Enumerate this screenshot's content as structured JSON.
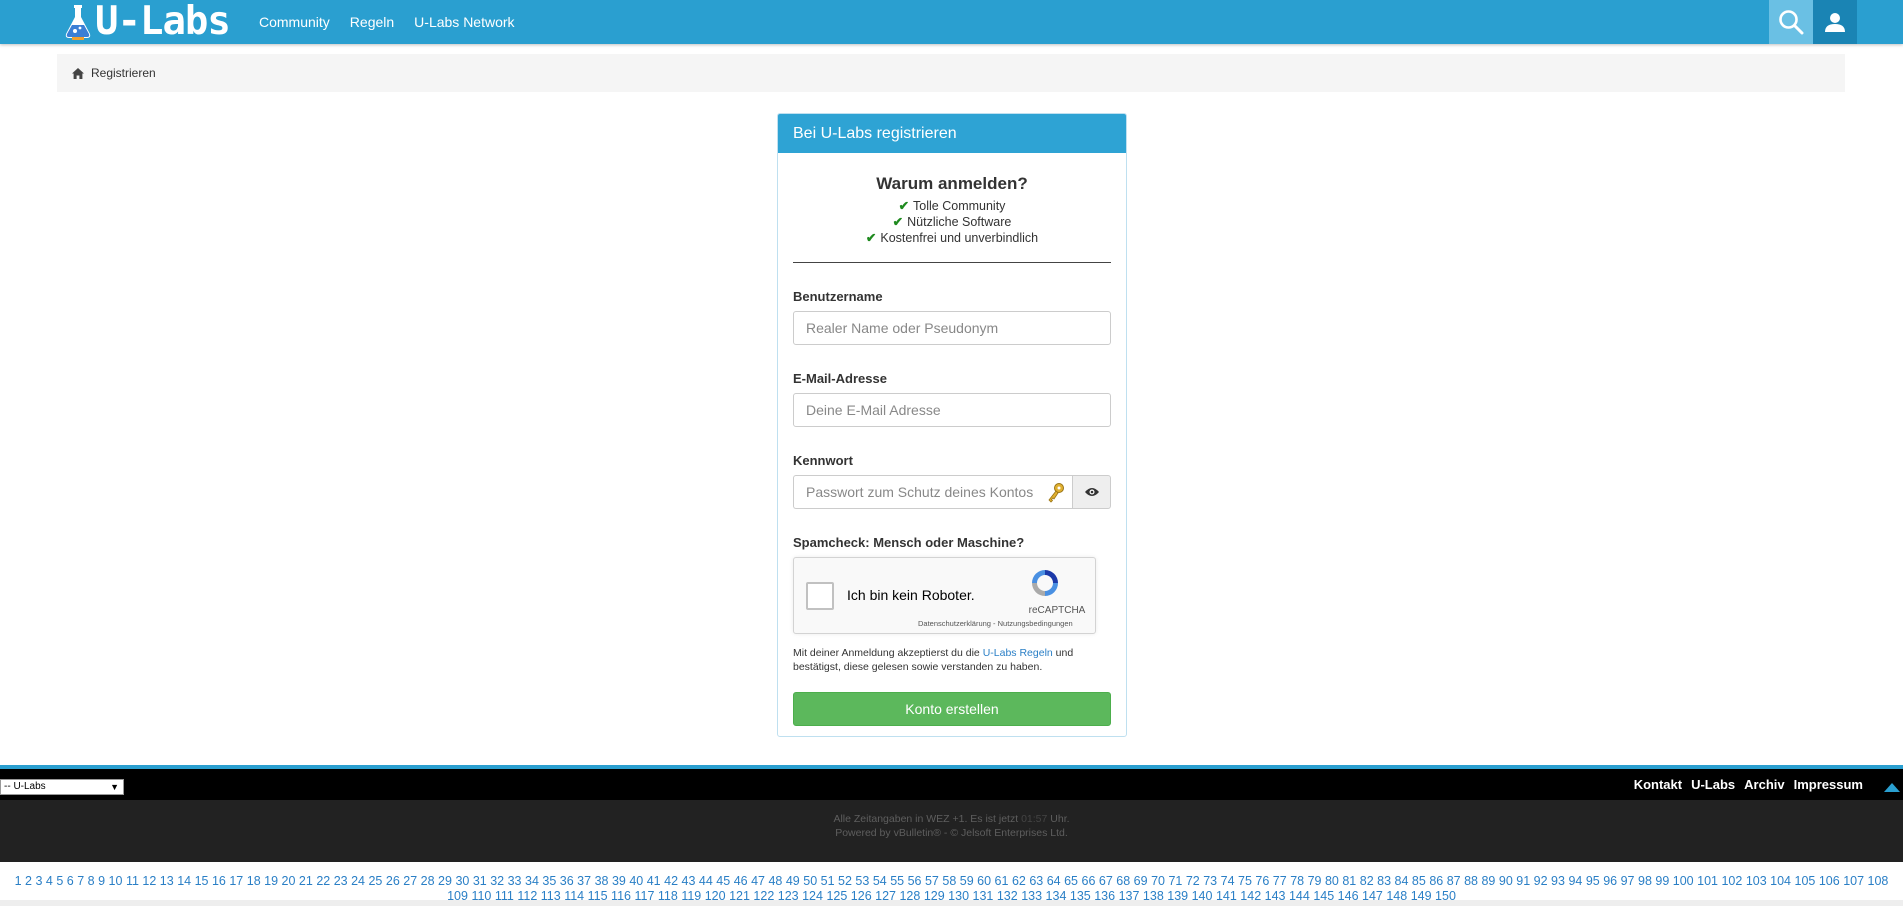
{
  "header": {
    "logo_text": "U-Labs",
    "nav": [
      {
        "label": "Community"
      },
      {
        "label": "Regeln"
      },
      {
        "label": "U-Labs Network"
      }
    ]
  },
  "breadcrumb": {
    "label": "Registrieren"
  },
  "register": {
    "title": "Bei U-Labs registrieren",
    "why_title": "Warum anmelden?",
    "benefits": [
      "Tolle Community",
      "Nützliche Software",
      "Kostenfrei und unverbindlich"
    ],
    "username_label": "Benutzername",
    "username_placeholder": "Realer Name oder Pseudonym",
    "email_label": "E-Mail-Adresse",
    "email_placeholder": "Deine E-Mail Adresse",
    "password_label": "Kennwort",
    "password_placeholder": "Passwort zum Schutz deines Kontos",
    "spam_label": "Spamcheck: Mensch oder Maschine?",
    "recaptcha": {
      "text": "Ich bin kein Roboter.",
      "brand": "reCAPTCHA",
      "links": "Datenschutzerklärung - Nutzungsbedingungen"
    },
    "terms_before": "Mit deiner Anmeldung akzeptierst du die ",
    "terms_link": "U-Labs Regeln",
    "terms_after": " und bestätigst, diese gelesen sowie verstanden zu haben.",
    "submit_label": "Konto erstellen"
  },
  "footer": {
    "style_selected": "-- U-Labs",
    "links": [
      "Kontakt",
      "U-Labs",
      "Archiv",
      "Impressum"
    ],
    "time_before": "Alle Zeitangaben in WEZ +1. Es ist jetzt ",
    "time_value": "01:57",
    "time_after": " Uhr.",
    "powered": "Powered by vBulletin® - © Jelsoft Enterprises Ltd.",
    "page_count": 150
  },
  "colors": {
    "brand_blue": "#2a9fd0",
    "success_green": "#5cb85c",
    "link_blue": "#2a7fc6"
  },
  "icons": [
    "flask-icon",
    "search-icon",
    "user-icon",
    "home-icon",
    "check-icon",
    "key-icon",
    "eye-icon",
    "recaptcha-icon",
    "arrow-up-icon",
    "caret-down-icon"
  ]
}
